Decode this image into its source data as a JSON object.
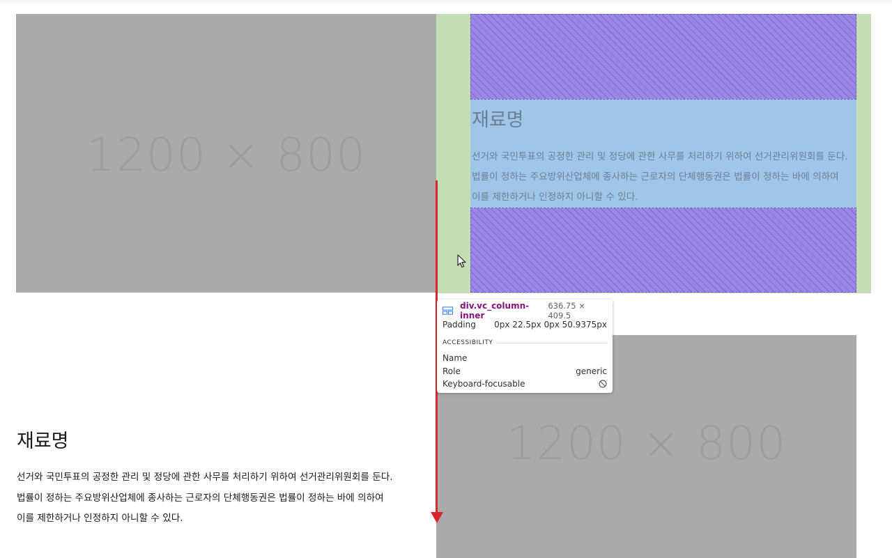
{
  "placeholders": {
    "top_label": "1200 × 800",
    "bottom_label": "1200 × 800"
  },
  "highlighted_column": {
    "title": "재료명",
    "lines": [
      "선거와 국민투표의 공정한 관리 및 정당에 관한 사무를 처리하기 위하여 선거관리위원회를 둔다.",
      "법률이 정하는 주요방위산업체에 종사하는 근로자의 단체행동권은 법률이 정하는 바에 의하여",
      "이를 제한하거나 인정하지 아니할 수 있다."
    ]
  },
  "tooltip": {
    "element": "div.vc_column-inner",
    "dimensions": "636.75 × 409.5",
    "padding_label": "Padding",
    "padding_value": "0px 22.5px 0px 50.9375px",
    "section_label": "ACCESSIBILITY",
    "name_label": "Name",
    "name_value": "",
    "role_label": "Role",
    "role_value": "generic",
    "focusable_label": "Keyboard-focusable",
    "focusable_icon": "no-entry-icon"
  },
  "bottom_column": {
    "title": "재료명",
    "lines": [
      "선거와 국민투표의 공정한 관리 및 정당에 관한 사무를 처리하기 위하여 선거관리위원회를 둔다.",
      "법률이 정하는 주요방위산업체에 종사하는 근로자의 단체행동권은 법률이 정하는 바에 의하여",
      "이를 제한하거나 인정하지 아니할 수 있다."
    ]
  },
  "colors": {
    "inspector_padding": "#c3ddb5",
    "inspector_content": "#9fc5e8",
    "inspector_margin_hatch": "#9a88e4",
    "annotation_arrow": "#d9262c"
  }
}
